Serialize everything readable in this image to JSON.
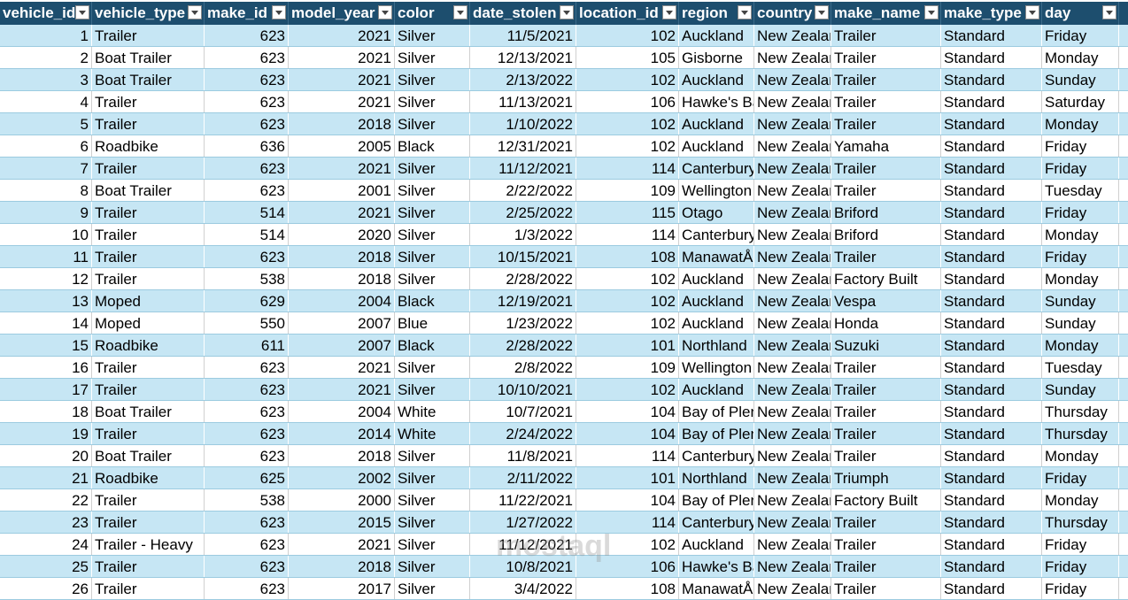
{
  "columns": [
    {
      "key": "vehicle_id",
      "label": "vehicle_id",
      "align": "right"
    },
    {
      "key": "vehicle_type",
      "label": "vehicle_type",
      "align": "left"
    },
    {
      "key": "make_id",
      "label": "make_id",
      "align": "right"
    },
    {
      "key": "model_year",
      "label": "model_year",
      "align": "right"
    },
    {
      "key": "color",
      "label": "color",
      "align": "left"
    },
    {
      "key": "date_stolen",
      "label": "date_stolen",
      "align": "right"
    },
    {
      "key": "location_id",
      "label": "location_id",
      "align": "right"
    },
    {
      "key": "region",
      "label": "region",
      "align": "left"
    },
    {
      "key": "country",
      "label": "country",
      "align": "left"
    },
    {
      "key": "make_name",
      "label": "make_name",
      "align": "left"
    },
    {
      "key": "make_type",
      "label": "make_type",
      "align": "left"
    },
    {
      "key": "day",
      "label": "day",
      "align": "left"
    }
  ],
  "rows": [
    [
      "1",
      "Trailer",
      "623",
      "2021",
      "Silver",
      "11/5/2021",
      "102",
      "Auckland",
      "New Zealand",
      "Trailer",
      "Standard",
      "Friday"
    ],
    [
      "2",
      "Boat Trailer",
      "623",
      "2021",
      "Silver",
      "12/13/2021",
      "105",
      "Gisborne",
      "New Zealand",
      "Trailer",
      "Standard",
      "Monday"
    ],
    [
      "3",
      "Boat Trailer",
      "623",
      "2021",
      "Silver",
      "2/13/2022",
      "102",
      "Auckland",
      "New Zealand",
      "Trailer",
      "Standard",
      "Sunday"
    ],
    [
      "4",
      "Trailer",
      "623",
      "2021",
      "Silver",
      "11/13/2021",
      "106",
      "Hawke's Bay",
      "New Zealand",
      "Trailer",
      "Standard",
      "Saturday"
    ],
    [
      "5",
      "Trailer",
      "623",
      "2018",
      "Silver",
      "1/10/2022",
      "102",
      "Auckland",
      "New Zealand",
      "Trailer",
      "Standard",
      "Monday"
    ],
    [
      "6",
      "Roadbike",
      "636",
      "2005",
      "Black",
      "12/31/2021",
      "102",
      "Auckland",
      "New Zealand",
      "Yamaha",
      "Standard",
      "Friday"
    ],
    [
      "7",
      "Trailer",
      "623",
      "2021",
      "Silver",
      "11/12/2021",
      "114",
      "Canterbury",
      "New Zealand",
      "Trailer",
      "Standard",
      "Friday"
    ],
    [
      "8",
      "Boat Trailer",
      "623",
      "2001",
      "Silver",
      "2/22/2022",
      "109",
      "Wellington",
      "New Zealand",
      "Trailer",
      "Standard",
      "Tuesday"
    ],
    [
      "9",
      "Trailer",
      "514",
      "2021",
      "Silver",
      "2/25/2022",
      "115",
      "Otago",
      "New Zealand",
      "Briford",
      "Standard",
      "Friday"
    ],
    [
      "10",
      "Trailer",
      "514",
      "2020",
      "Silver",
      "1/3/2022",
      "114",
      "Canterbury",
      "New Zealand",
      "Briford",
      "Standard",
      "Monday"
    ],
    [
      "11",
      "Trailer",
      "623",
      "2018",
      "Silver",
      "10/15/2021",
      "108",
      "ManawatÅ«",
      "New Zealand",
      "Trailer",
      "Standard",
      "Friday"
    ],
    [
      "12",
      "Trailer",
      "538",
      "2018",
      "Silver",
      "2/28/2022",
      "102",
      "Auckland",
      "New Zealand",
      "Factory Built",
      "Standard",
      "Monday"
    ],
    [
      "13",
      "Moped",
      "629",
      "2004",
      "Black",
      "12/19/2021",
      "102",
      "Auckland",
      "New Zealand",
      "Vespa",
      "Standard",
      "Sunday"
    ],
    [
      "14",
      "Moped",
      "550",
      "2007",
      "Blue",
      "1/23/2022",
      "102",
      "Auckland",
      "New Zealand",
      "Honda",
      "Standard",
      "Sunday"
    ],
    [
      "15",
      "Roadbike",
      "611",
      "2007",
      "Black",
      "2/28/2022",
      "101",
      "Northland",
      "New Zealand",
      "Suzuki",
      "Standard",
      "Monday"
    ],
    [
      "16",
      "Trailer",
      "623",
      "2021",
      "Silver",
      "2/8/2022",
      "109",
      "Wellington",
      "New Zealand",
      "Trailer",
      "Standard",
      "Tuesday"
    ],
    [
      "17",
      "Trailer",
      "623",
      "2021",
      "Silver",
      "10/10/2021",
      "102",
      "Auckland",
      "New Zealand",
      "Trailer",
      "Standard",
      "Sunday"
    ],
    [
      "18",
      "Boat Trailer",
      "623",
      "2004",
      "White",
      "10/7/2021",
      "104",
      "Bay of Plenty",
      "New Zealand",
      "Trailer",
      "Standard",
      "Thursday"
    ],
    [
      "19",
      "Trailer",
      "623",
      "2014",
      "White",
      "2/24/2022",
      "104",
      "Bay of Plenty",
      "New Zealand",
      "Trailer",
      "Standard",
      "Thursday"
    ],
    [
      "20",
      "Boat Trailer",
      "623",
      "2018",
      "Silver",
      "11/8/2021",
      "114",
      "Canterbury",
      "New Zealand",
      "Trailer",
      "Standard",
      "Monday"
    ],
    [
      "21",
      "Roadbike",
      "625",
      "2002",
      "Silver",
      "2/11/2022",
      "101",
      "Northland",
      "New Zealand",
      "Triumph",
      "Standard",
      "Friday"
    ],
    [
      "22",
      "Trailer",
      "538",
      "2000",
      "Silver",
      "11/22/2021",
      "104",
      "Bay of Plenty",
      "New Zealand",
      "Factory Built",
      "Standard",
      "Monday"
    ],
    [
      "23",
      "Trailer",
      "623",
      "2015",
      "Silver",
      "1/27/2022",
      "114",
      "Canterbury",
      "New Zealand",
      "Trailer",
      "Standard",
      "Thursday"
    ],
    [
      "24",
      "Trailer - Heavy",
      "623",
      "2021",
      "Silver",
      "11/12/2021",
      "102",
      "Auckland",
      "New Zealand",
      "Trailer",
      "Standard",
      "Friday"
    ],
    [
      "25",
      "Trailer",
      "623",
      "2018",
      "Silver",
      "10/8/2021",
      "106",
      "Hawke's Bay",
      "New Zealand",
      "Trailer",
      "Standard",
      "Friday"
    ],
    [
      "26",
      "Trailer",
      "623",
      "2017",
      "Silver",
      "3/4/2022",
      "108",
      "ManawatÅ«",
      "New Zealand",
      "Trailer",
      "Standard",
      "Friday"
    ]
  ],
  "watermark": "mostaql",
  "colors": {
    "header_bg": "#1d4e6e",
    "band_bg": "#c6e6f4",
    "header_text": "#ffffff"
  }
}
